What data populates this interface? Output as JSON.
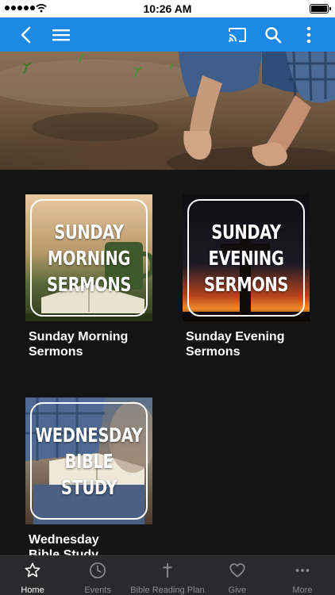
{
  "status_bar": {
    "time": "10:26 AM",
    "signal_bars": 5
  },
  "app_bar": {
    "color": "#1e88e5",
    "icons": [
      "back-chevron-icon",
      "menu-icon",
      "cast-icon",
      "search-icon",
      "more-vertical-icon"
    ]
  },
  "hero": {
    "icon": "hands-planting-seeds-photo"
  },
  "grid": {
    "items": [
      {
        "thumb_lines": [
          "SUNDAY",
          "MORNING",
          "SERMONS"
        ],
        "label_lines": [
          "Sunday Morning",
          "Sermons"
        ]
      },
      {
        "thumb_lines": [
          "SUNDAY",
          "EVENING",
          "SERMONS"
        ],
        "label_lines": [
          "Sunday Evening",
          "Sermons"
        ]
      },
      {
        "thumb_lines": [
          "WEDNESDAY",
          "BIBLE",
          "STUDY"
        ],
        "label_lines": [
          "Wednesday",
          "Bible Study"
        ]
      }
    ]
  },
  "tab_bar": {
    "active_color": "#ffffff",
    "inactive_color": "#8d8d90",
    "tabs": [
      {
        "label": "Home",
        "icon": "star-icon",
        "active": true
      },
      {
        "label": "Events",
        "icon": "clock-icon",
        "active": false
      },
      {
        "label": "Bible Reading Plan",
        "icon": "cross-icon",
        "active": false
      },
      {
        "label": "Give",
        "icon": "heart-icon",
        "active": false
      },
      {
        "label": "More",
        "icon": "more-horizontal-icon",
        "active": false
      }
    ]
  }
}
